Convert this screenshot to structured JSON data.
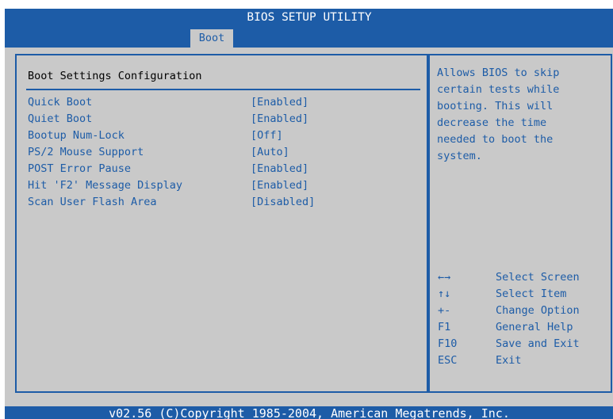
{
  "header": {
    "title": "BIOS SETUP UTILITY",
    "active_tab": "Boot"
  },
  "main": {
    "section_title": "Boot Settings Configuration",
    "settings": [
      {
        "name": "Quick Boot",
        "value": "[Enabled]"
      },
      {
        "name": "Quiet Boot",
        "value": "[Enabled]"
      },
      {
        "name": "Bootup Num-Lock",
        "value": "[Off]"
      },
      {
        "name": "PS/2 Mouse Support",
        "value": "[Auto]"
      },
      {
        "name": "POST Error Pause",
        "value": "[Enabled]"
      },
      {
        "name": "Hit 'F2' Message Display",
        "value": "[Enabled]"
      },
      {
        "name": "Scan User Flash Area",
        "value": "[Disabled]"
      }
    ]
  },
  "help": {
    "description": "Allows BIOS to skip\ncertain tests while\nbooting. This will\ndecrease the time\nneeded to boot the\nsystem.",
    "keys": [
      {
        "key": "←→",
        "desc": "Select Screen"
      },
      {
        "key": "↑↓",
        "desc": "Select Item"
      },
      {
        "key": "+-",
        "desc": "Change Option"
      },
      {
        "key": "F1",
        "desc": "General Help"
      },
      {
        "key": "F10",
        "desc": "Save and Exit"
      },
      {
        "key": "ESC",
        "desc": "Exit"
      }
    ]
  },
  "footer": {
    "copyright": "v02.56 (C)Copyright 1985-2004, American Megatrends, Inc."
  },
  "colors": {
    "accent_blue": "#1d5ca7",
    "panel_gray": "#c9c9c9",
    "text_white": "#ffffff"
  }
}
